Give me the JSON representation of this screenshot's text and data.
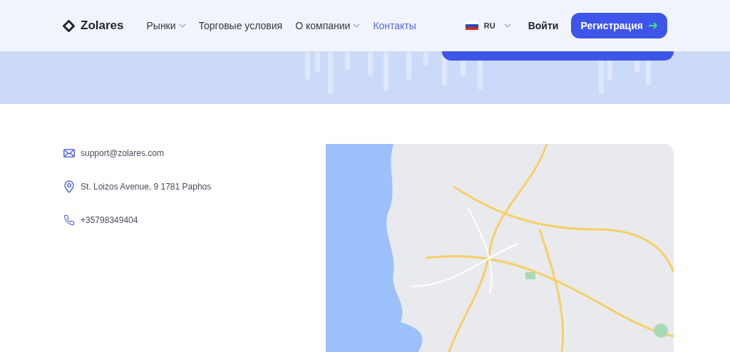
{
  "header": {
    "logo": "Zolares",
    "nav": [
      {
        "label": "Рынки",
        "dropdown": true,
        "selected": false
      },
      {
        "label": "Торговые условия",
        "dropdown": false,
        "selected": false
      },
      {
        "label": "О компании",
        "dropdown": true,
        "selected": false
      },
      {
        "label": "Контакты",
        "dropdown": false,
        "selected": true
      }
    ],
    "language": "RU",
    "login": "Войти",
    "register": "Регистрация"
  },
  "contacts": [
    {
      "kind": "email",
      "text": "support@zolares.com"
    },
    {
      "kind": "address",
      "text": "St. Loizos Avenue, 9 1781 Paphos"
    },
    {
      "kind": "phone",
      "text": "+35798349404"
    }
  ]
}
